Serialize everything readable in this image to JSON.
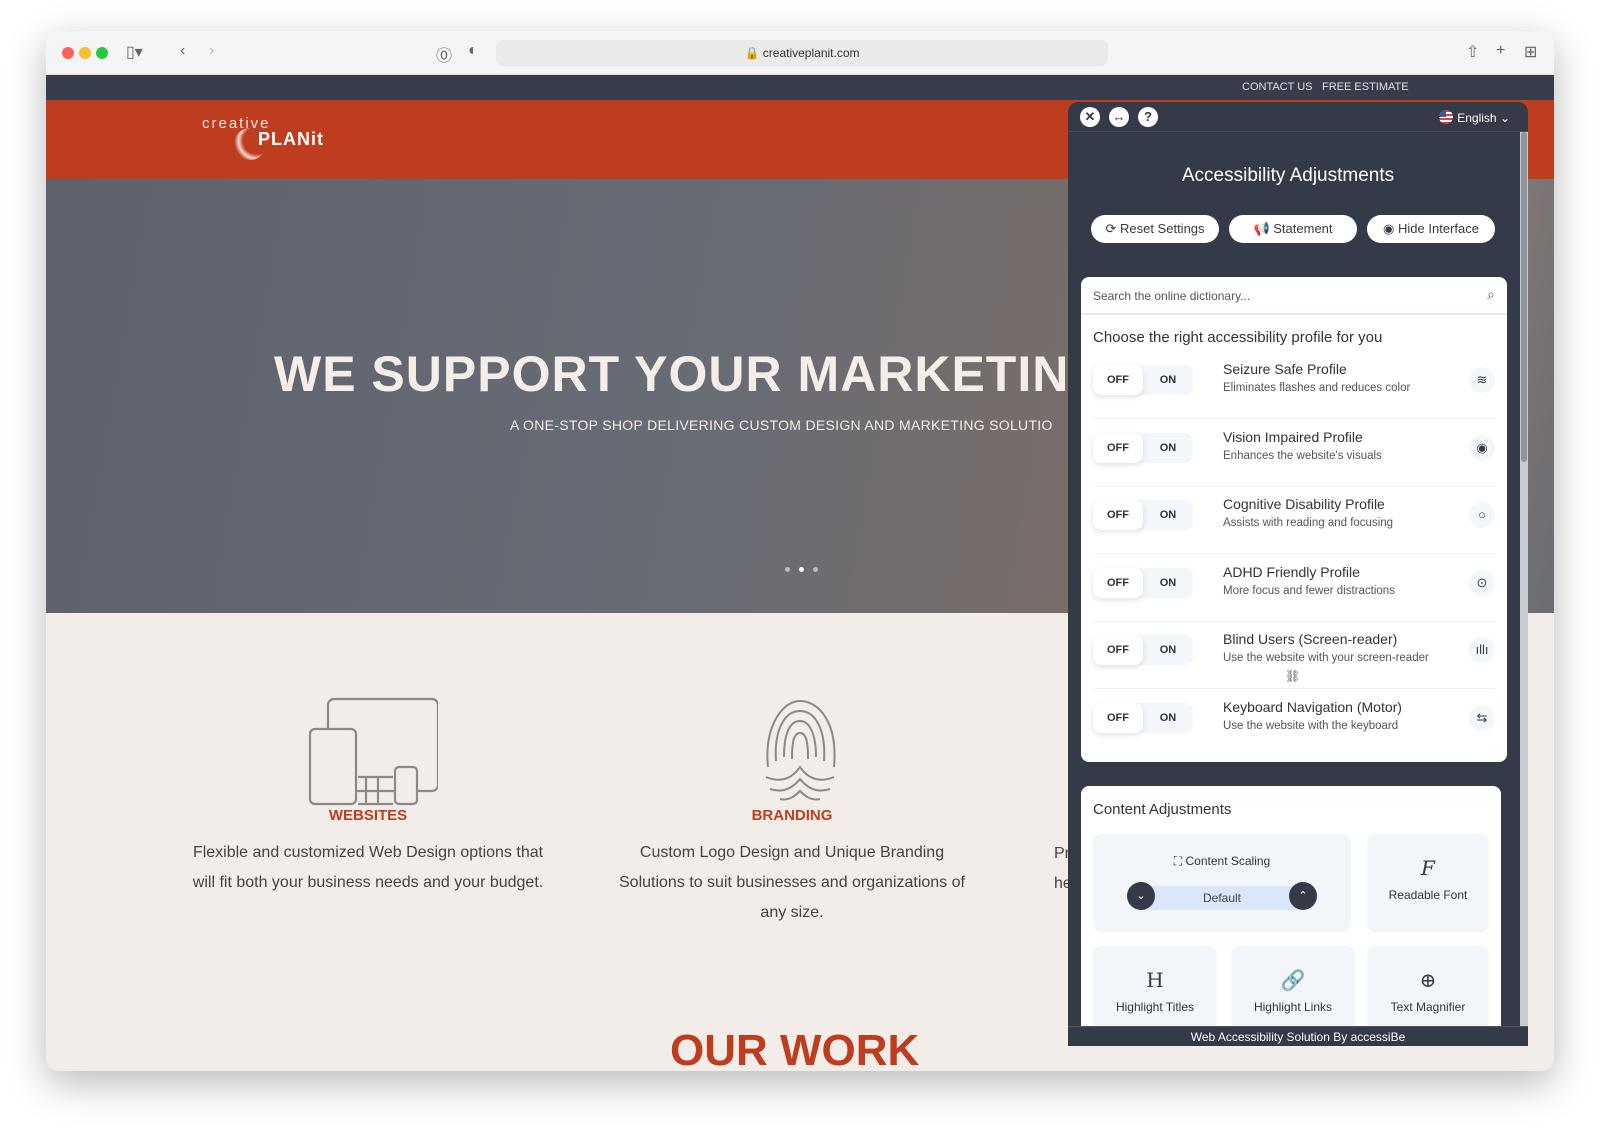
{
  "browser": {
    "url": "creativeplanit.com"
  },
  "topbar": {
    "links": [
      "CONTACT US",
      "FREE ESTIMATE"
    ]
  },
  "logo": {
    "line1": "creative",
    "line2": "PLANit"
  },
  "hero": {
    "title": "WE SUPPORT YOUR MARKETIN",
    "subtitle": "A ONE-STOP SHOP DELIVERING CUSTOM DESIGN AND MARKETING SOLUTIO",
    "active_slide": 2,
    "slide_count": 3
  },
  "services": [
    {
      "title": "WEBSITES",
      "text": "Flexible and customized Web Design options that will fit both your business needs and your budget."
    },
    {
      "title": "BRANDING",
      "text": "Custom Logo Design and Unique Branding Solutions to suit businesses and organizations of any size."
    },
    {
      "title": "",
      "text": "Pr he"
    }
  ],
  "section_heading": "OUR WORK",
  "panel": {
    "language": "English",
    "title": "Accessibility Adjustments",
    "buttons": {
      "reset": "Reset Settings",
      "statement": "Statement",
      "hide": "Hide Interface"
    },
    "search_placeholder": "Search the online dictionary...",
    "profiles_heading": "Choose the right accessibility profile for you",
    "toggle": {
      "off": "OFF",
      "on": "ON"
    },
    "profiles": [
      {
        "name": "Seizure Safe Profile",
        "desc": "Eliminates flashes and reduces color",
        "icon": "≋"
      },
      {
        "name": "Vision Impaired Profile",
        "desc": "Enhances the website's visuals",
        "icon": "◉"
      },
      {
        "name": "Cognitive Disability Profile",
        "desc": "Assists with reading and focusing",
        "icon": "○"
      },
      {
        "name": "ADHD Friendly Profile",
        "desc": "More focus and fewer distractions",
        "icon": "⊙"
      },
      {
        "name": "Blind Users (Screen-reader)",
        "desc": "Use the website with your screen-reader",
        "icon": "ıllı"
      },
      {
        "name": "Keyboard Navigation (Motor)",
        "desc": "Use the website with the keyboard",
        "icon": "⇆"
      }
    ],
    "content_heading": "Content Adjustments",
    "content_scaling": {
      "label": "Content Scaling",
      "value": "Default"
    },
    "tiles": [
      "Readable Font",
      "Highlight Titles",
      "Highlight Links",
      "Text Magnifier"
    ],
    "footer": "Web Accessibility Solution By accessiBe"
  }
}
